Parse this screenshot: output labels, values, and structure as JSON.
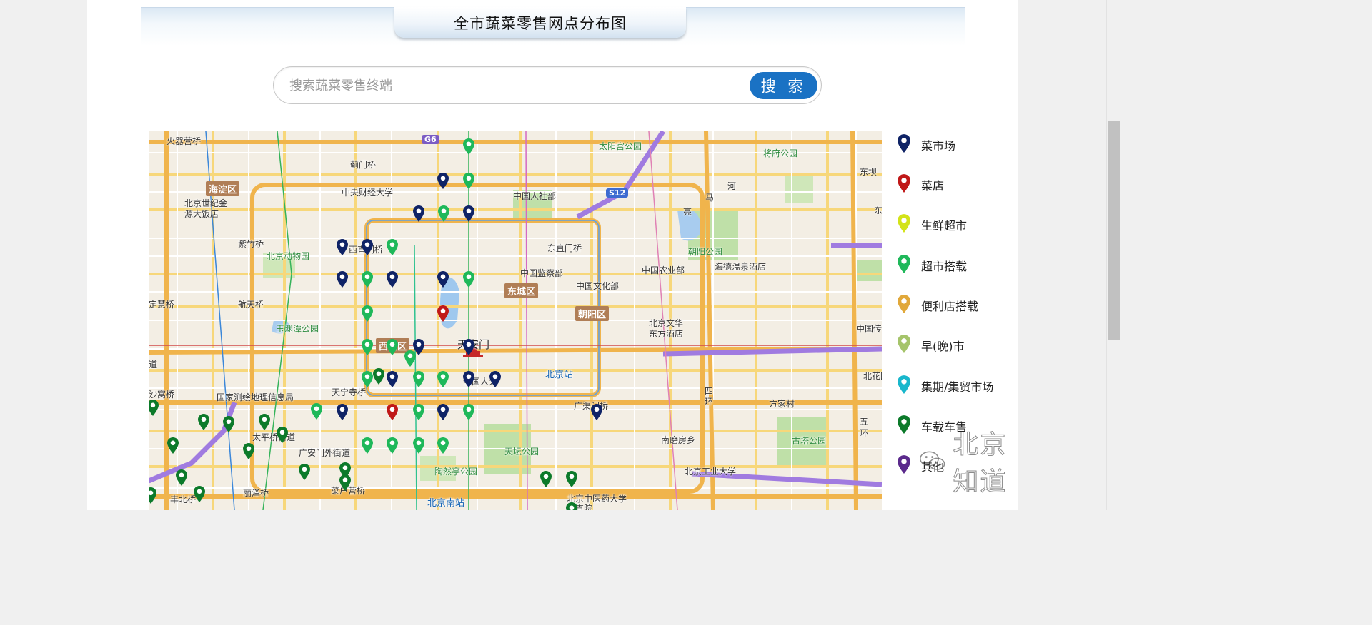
{
  "header": {
    "title": "全市蔬菜零售网点分布图"
  },
  "search": {
    "placeholder": "搜索蔬菜零售终端",
    "button_label": "搜 索"
  },
  "legend": [
    {
      "label": "菜市场",
      "color": "#0f2366"
    },
    {
      "label": "菜店",
      "color": "#c01818"
    },
    {
      "label": "生鲜超市",
      "color": "#d3e318"
    },
    {
      "label": "超市搭载",
      "color": "#1fb85a"
    },
    {
      "label": "便利店搭载",
      "color": "#e1a83a"
    },
    {
      "label": "早(晚)市",
      "color": "#a5c46a"
    },
    {
      "label": "集期/集贸市场",
      "color": "#19b7cc"
    },
    {
      "label": "车载车售",
      "color": "#0c7a2a"
    },
    {
      "label": "其他",
      "color": "#5b2a8c"
    }
  ],
  "map": {
    "labels": [
      "火器营桥",
      "蓟门桥",
      "中央财经大学",
      "太阳宫公园",
      "将府公园",
      "海淀区",
      "北京世纪金",
      "源大饭店",
      "中国人社部",
      "紫竹桥",
      "北京动物园",
      "西直门桥",
      "东直门桥",
      "朝阳公园",
      "海德温泉酒店",
      "中国监察部",
      "中国农业部",
      "东城区",
      "中国文化部",
      "朝阳区",
      "航天桥",
      "定慧桥",
      "玉渊潭公园",
      "西城区",
      "天安门",
      "北京文华",
      "东方酒店",
      "中国传",
      "道",
      "北京站",
      "北花园",
      "沙窝桥",
      "国家测绘地理信息局",
      "天宁寺桥",
      "全国人大",
      "广渠门桥",
      "四",
      "环",
      "方家村",
      "五",
      "环",
      "太平桥街道",
      "广安门外街道",
      "天坛公园",
      "南磨房乡",
      "古塔公园",
      "陶然亭公园",
      "北京工业大学",
      "菜户营桥",
      "丽泽桥",
      "丰北桥",
      "北京南站",
      "北京中医药大学",
      "东直院",
      "亮",
      "马",
      "河",
      "东坝",
      "东"
    ],
    "shields": [
      "G6",
      "S12"
    ]
  },
  "watermark": {
    "text": "北京知道"
  }
}
